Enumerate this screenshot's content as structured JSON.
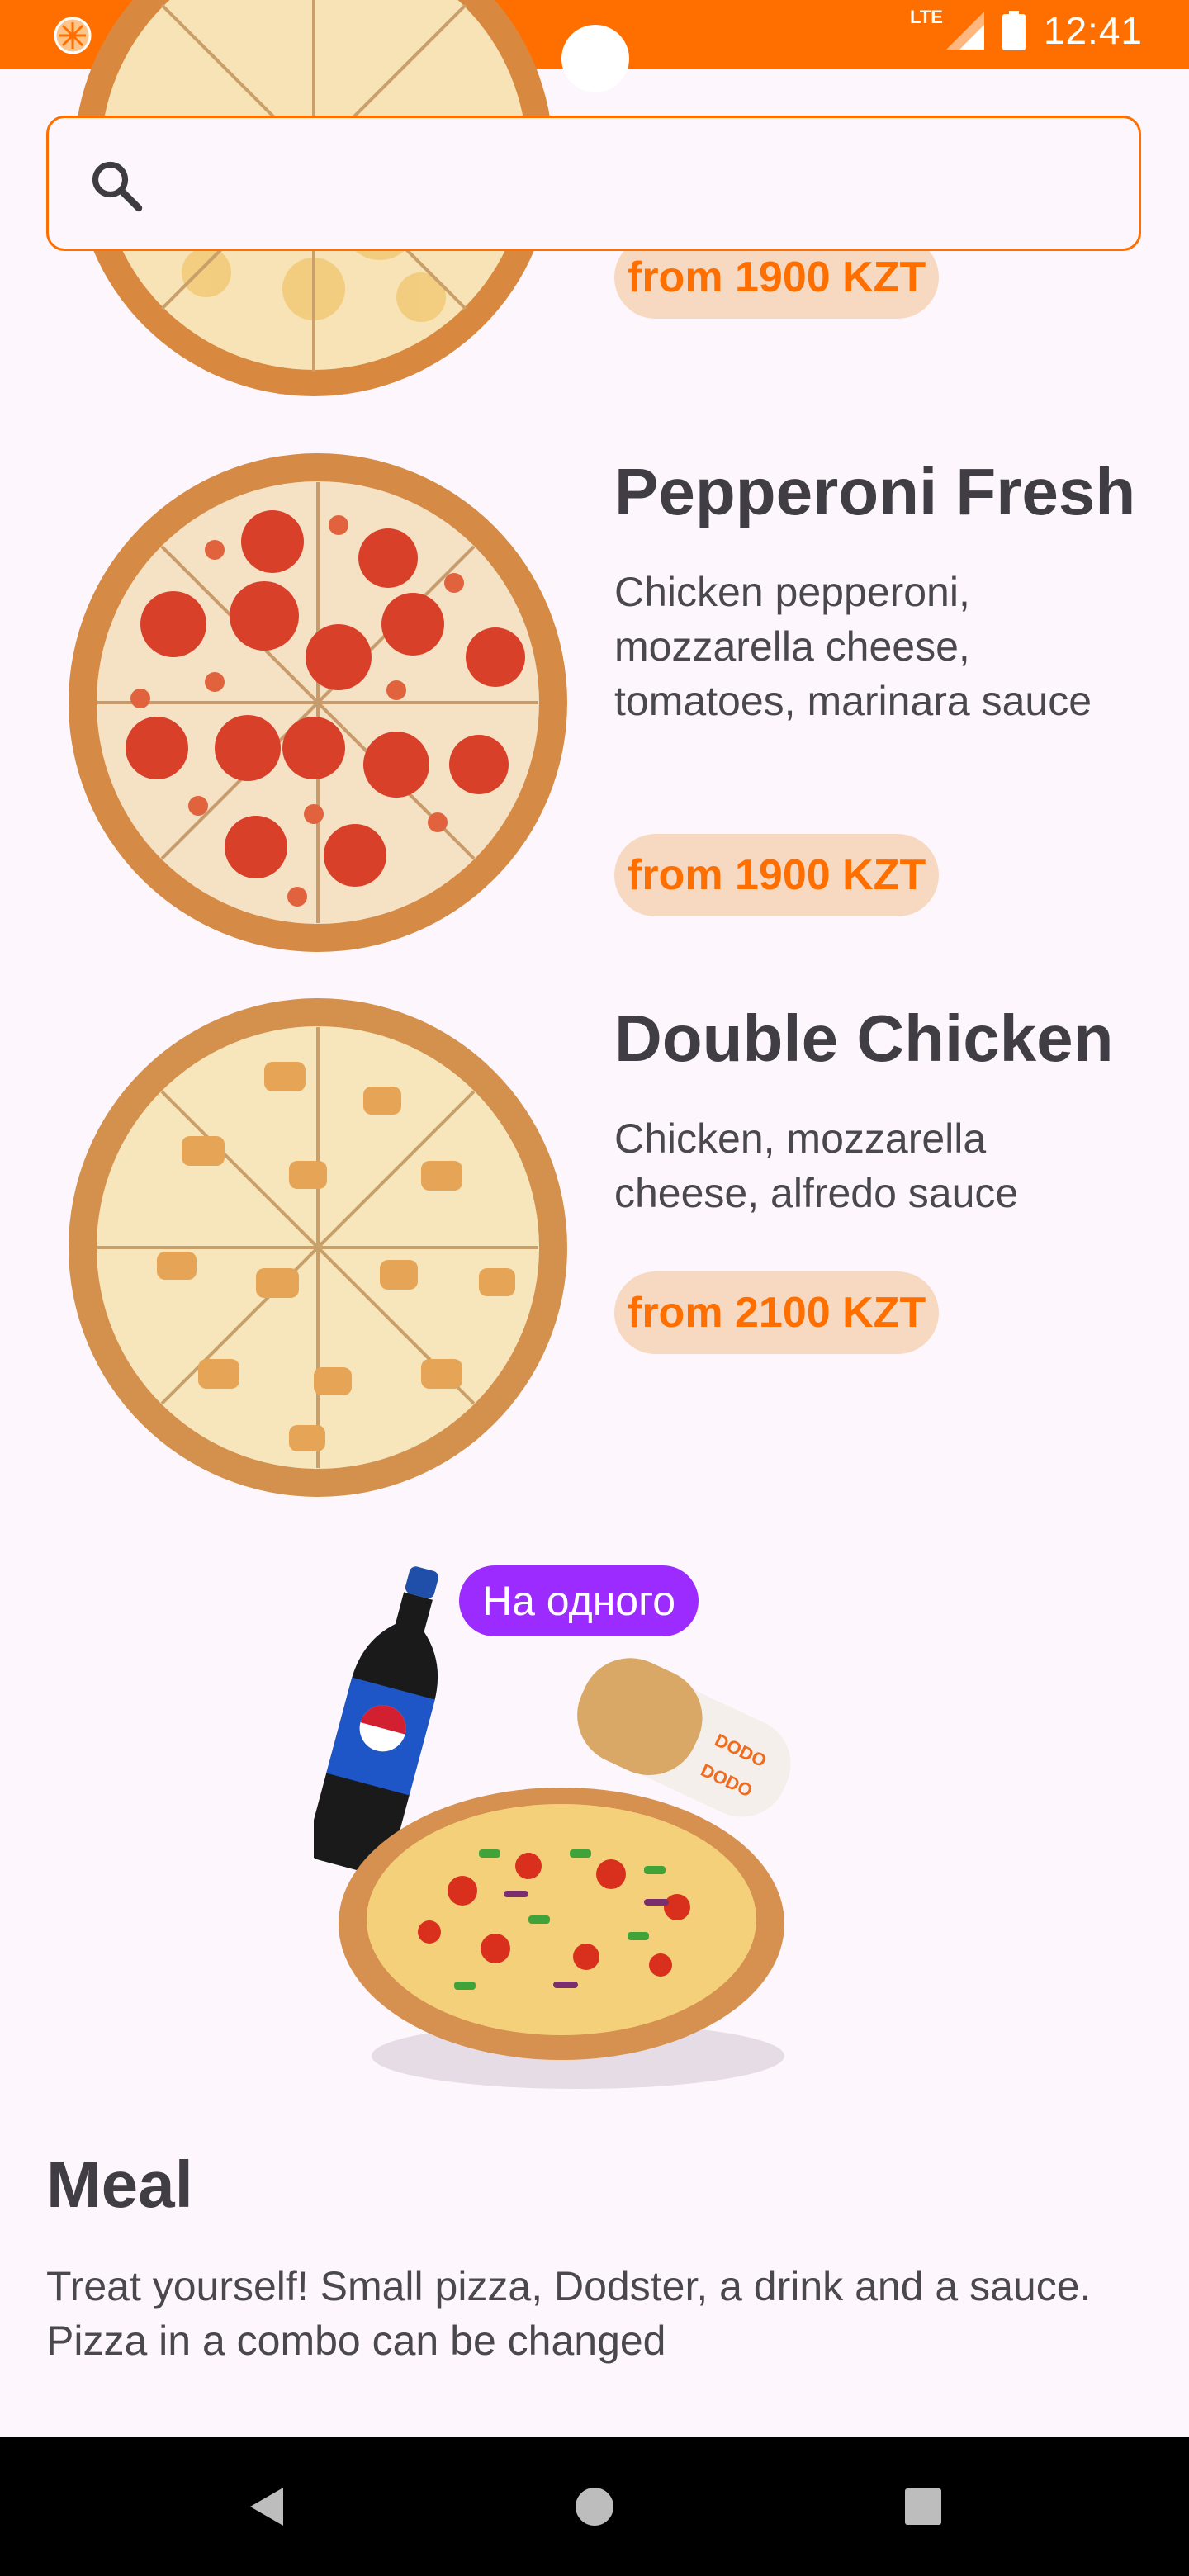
{
  "status_bar": {
    "network": "LTE",
    "time": "12:41"
  },
  "search": {
    "value": "",
    "placeholder": ""
  },
  "products": [
    {
      "title": "",
      "description": "",
      "price": "from 1900 KZT",
      "image": "cheese-pizza"
    },
    {
      "title": "Pepperoni Fresh",
      "description": "Chicken pepperoni, mozzarella cheese, tomatoes, marinara sauce",
      "price": "from 1900 KZT",
      "image": "pepperoni-pizza"
    },
    {
      "title": "Double Chicken",
      "description": "Chicken, mozzarella cheese, alfredo sauce",
      "price": "from 2100 KZT",
      "image": "chicken-pizza"
    }
  ],
  "combo": {
    "badge": "На одного",
    "title": "Meal",
    "description": "Treat yourself! Small pizza, Dodster, a drink and a sauce. Pizza in a combo can be changed",
    "image": "meal-combo"
  },
  "colors": {
    "accent": "#FF6F00",
    "price_bg": "#F7D8C1",
    "badge": "#9B2BFF",
    "background": "#FDF7FD"
  },
  "nav": {
    "icons": [
      "back-icon",
      "home-icon",
      "recents-icon"
    ]
  }
}
